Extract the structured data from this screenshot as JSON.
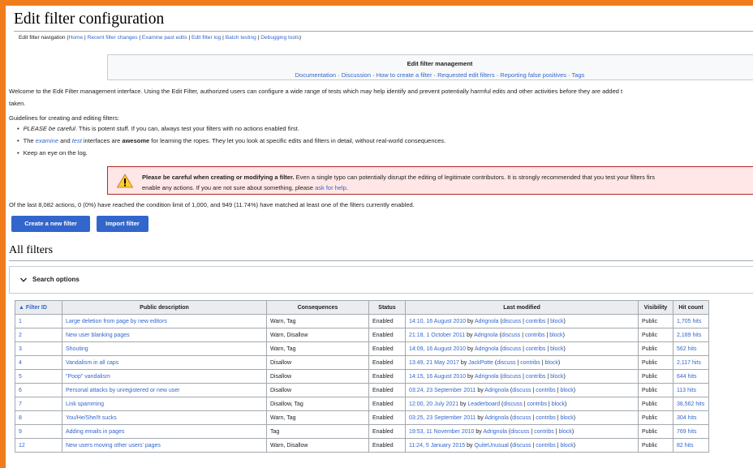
{
  "page": {
    "title": "Edit filter configuration",
    "nav": {
      "prefix": "Edit filter navigation (",
      "items": [
        "Home",
        "Recent filter changes",
        "Examine past edits",
        "Edit filter log",
        "Batch testing",
        "Debugging tools"
      ],
      "suffix": ")"
    }
  },
  "management": {
    "title": "Edit filter management",
    "links": [
      "Documentation",
      "Discussion",
      "How to create a filter",
      "Requested edit filters",
      "Reporting false positives",
      "Tags"
    ]
  },
  "intro": {
    "line1": "Welcome to the Edit Filter management interface. Using the Edit Filter, authorized users can configure a wide range of tests which may help identify and prevent potentially harmful edits and other activities before they are added t",
    "line2": "taken.",
    "guidelines": "Guidelines for creating and editing filters:"
  },
  "bullets": {
    "b1_em": "PLEASE be careful",
    "b1_rest": ". This is potent stuff. If you can, always test your filters with no actions enabled first.",
    "b2_a": "The ",
    "b2_examine": "examine",
    "b2_and": " and ",
    "b2_test": "test",
    "b2_b": " interfaces are ",
    "b2_awesome": "awesome",
    "b2_c": " for learning the ropes. They let you look at specific edits and filters in detail, without real-world consequences.",
    "b3": "Keep an eye on the log."
  },
  "warning": {
    "bold": "Please be careful when creating or modifying a filter.",
    "rest": " Even a single typo can potentially disrupt the editing of legitimate contributors. It is strongly recommended that you test your filters firs",
    "line2_a": "enable any actions. If you are not sure about something, please ",
    "line2_link": "ask for help",
    "line2_b": "."
  },
  "stats": "Of the last 8,082 actions, 0 (0%) have reached the condition limit of 1,000, and 949 (11.74%) have matched at least one of the filters currently enabled.",
  "buttons": {
    "create": "Create a new filter",
    "import": "Import filter"
  },
  "all_filters": {
    "heading": "All filters",
    "search_label": "Search options"
  },
  "table": {
    "headers": {
      "id": "▲ Filter ID",
      "desc": "Public description",
      "cons": "Consequences",
      "status": "Status",
      "modified": "Last modified",
      "visibility": "Visibility",
      "hits": "Hit count"
    },
    "rows": [
      {
        "id": "1",
        "desc": "Large deletion from page by new editors",
        "cons": "Warn, Tag",
        "status": "Enabled",
        "date": "14:10, 16 August 2010",
        "by": " by ",
        "user": "Adrignola",
        "hits": "1,705 hits",
        "vis": "Public"
      },
      {
        "id": "2",
        "desc": "New user blanking pages",
        "cons": "Warn, Disallow",
        "status": "Enabled",
        "date": "21:18, 1 October 2011",
        "by": " by ",
        "user": "Adrignola",
        "hits": "2,189 hits",
        "vis": "Public"
      },
      {
        "id": "3",
        "desc": "Shouting",
        "cons": "Warn, Tag",
        "status": "Enabled",
        "date": "14:09, 16 August 2010",
        "by": " by ",
        "user": "Adrignola",
        "hits": "562 hits",
        "vis": "Public"
      },
      {
        "id": "4",
        "desc": "Vandalism in all caps",
        "cons": "Disallow",
        "status": "Enabled",
        "date": "13:49, 21 May 2017",
        "by": " by ",
        "user": "JackPotte",
        "hits": "2,117 hits",
        "vis": "Public"
      },
      {
        "id": "5",
        "desc": "\"Poop\" vandalism",
        "cons": "Disallow",
        "status": "Enabled",
        "date": "14:15, 16 August 2010",
        "by": " by ",
        "user": "Adrignola",
        "hits": "644 hits",
        "vis": "Public"
      },
      {
        "id": "6",
        "desc": "Personal attacks by unregistered or new user",
        "cons": "Disallow",
        "status": "Enabled",
        "date": "03:24, 23 September 2011",
        "by": " by ",
        "user": "Adrignola",
        "hits": "113 hits",
        "vis": "Public"
      },
      {
        "id": "7",
        "desc": "Link spamming",
        "cons": "Disallow, Tag",
        "status": "Enabled",
        "date": "12:00, 20 July 2021",
        "by": " by ",
        "user": "Leaderboard",
        "hits": "38,562 hits",
        "vis": "Public"
      },
      {
        "id": "8",
        "desc": "You/He/She/It sucks",
        "cons": "Warn, Tag",
        "status": "Enabled",
        "date": "03:25, 23 September 2011",
        "by": " by ",
        "user": "Adrignola",
        "hits": "304 hits",
        "vis": "Public"
      },
      {
        "id": "9",
        "desc": "Adding emails in pages",
        "cons": "Tag",
        "status": "Enabled",
        "date": "19:53, 11 November 2010",
        "by": " by ",
        "user": "Adrignola",
        "hits": "769 hits",
        "vis": "Public"
      },
      {
        "id": "12",
        "desc": "New users moving other users' pages",
        "cons": "Warn, Disallow",
        "status": "Enabled",
        "date": "11:24, 5 January 2015",
        "by": " by ",
        "user": "QuiteUnusual",
        "hits": "82 hits",
        "vis": "Public"
      }
    ],
    "user_links": {
      "open": " (",
      "discuss": "discuss",
      "contribs": "contribs",
      "block": "block",
      "sep": " | ",
      "close": ")"
    }
  },
  "colors": {
    "frame": "#f07c1c",
    "link": "#3366cc",
    "button": "#3366cc",
    "warning_border": "#b32424",
    "warning_bg": "#fee7e6"
  }
}
